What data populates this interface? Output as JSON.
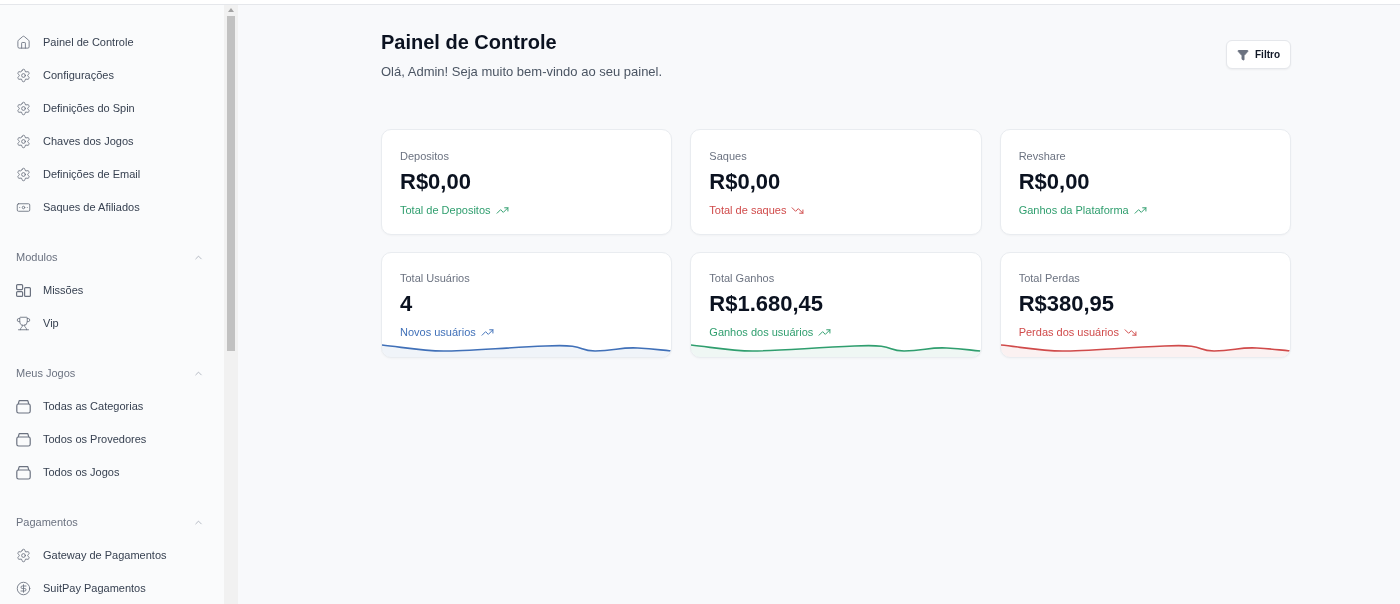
{
  "sidebar": {
    "items": [
      {
        "label": "Painel de Controle",
        "kind": "home"
      },
      {
        "label": "Configurações",
        "kind": "gear"
      },
      {
        "label": "Definições do Spin",
        "kind": "gear"
      },
      {
        "label": "Chaves dos Jogos",
        "kind": "gear"
      },
      {
        "label": "Definições de Email",
        "kind": "gear"
      },
      {
        "label": "Saques de Afiliados",
        "kind": "cash"
      }
    ],
    "sections": [
      {
        "title": "Modulos",
        "expanded": true,
        "items": [
          {
            "label": "Missões",
            "kind": "layout"
          },
          {
            "label": "Vip",
            "kind": "trophy"
          }
        ]
      },
      {
        "title": "Meus Jogos",
        "expanded": true,
        "items": [
          {
            "label": "Todas as Categorias",
            "kind": "tray"
          },
          {
            "label": "Todos os Provedores",
            "kind": "tray"
          },
          {
            "label": "Todos os Jogos",
            "kind": "tray"
          }
        ]
      },
      {
        "title": "Pagamentos",
        "expanded": true,
        "items": [
          {
            "label": "Gateway de Pagamentos",
            "kind": "gear"
          },
          {
            "label": "SuitPay Pagamentos",
            "kind": "dollar"
          }
        ]
      }
    ]
  },
  "header": {
    "title": "Painel de Controle",
    "subtitle": "Olá, Admin! Seja muito bem-vindo ao seu painel."
  },
  "filter_button": {
    "label": "Filtro"
  },
  "cards": [
    {
      "kind": "plain",
      "label": "Depositos",
      "value": "R$0,00",
      "caption": "Total de Depositos",
      "rising": true,
      "color": "#2f9e6e"
    },
    {
      "kind": "plain",
      "label": "Saques",
      "value": "R$0,00",
      "caption": "Total de saques",
      "rising": false,
      "color": "#d04a4a"
    },
    {
      "kind": "plain",
      "label": "Revshare",
      "value": "R$0,00",
      "caption": "Ganhos da Plataforma",
      "rising": true,
      "color": "#2f9e6e"
    },
    {
      "kind": "sparkline",
      "label": "Total Usuários",
      "value": "4",
      "caption": "Novos usuários",
      "rising": true,
      "color": "#4070b8"
    },
    {
      "kind": "sparkline",
      "label": "Total Ganhos",
      "value": "R$1.680,45",
      "caption": "Ganhos dos usuários",
      "rising": true,
      "color": "#2f9e6e"
    },
    {
      "kind": "sparkline",
      "label": "Total Perdas",
      "value": "R$380,95",
      "caption": "Perdas dos usuários",
      "rising": false,
      "color": "#d04a4a"
    }
  ]
}
